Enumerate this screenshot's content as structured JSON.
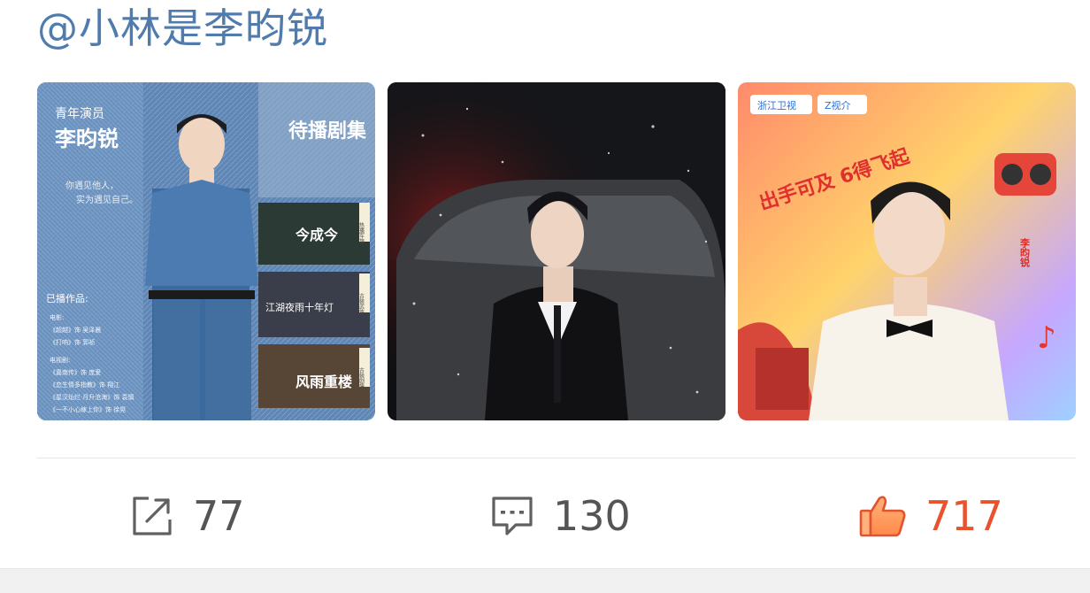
{
  "post": {
    "mention": "@小林是李昀锐"
  },
  "images": [
    {
      "title": "待播剧集",
      "subtitle_role": "青年演员",
      "name": "李昀锐",
      "quote_lines": [
        "你遇见他人，",
        "实为遇见自己。"
      ],
      "works_heading": "已播作品:",
      "works_lines": [
        "电影:",
        "《超越》饰 吴泽晨",
        "《打响》饰 郭祯",
        "电视剧:",
        "《嘉南传》饰 庞爱",
        "《恋生情多指教》饰 翔江",
        "《星汉灿烂·月升沧海》饰 袁慎",
        "《一不小心嫁上你》饰 徐晃"
      ],
      "panels": [
        {
          "title": "今成今",
          "tag": "热播军旅"
        },
        {
          "title": "江湖夜雨十年灯",
          "tag": "古装武侠"
        },
        {
          "title": "风雨重楼",
          "tag": "古装剧情"
        }
      ]
    },
    {
      "description_free": true
    },
    {
      "channel_badges": [
        "浙江卫视",
        "Z视介"
      ],
      "headline": "出手可及 6得飞起",
      "name_tag": "李昀锐"
    }
  ],
  "actions": {
    "repost_count": "77",
    "comment_count": "130",
    "like_count": "717"
  },
  "colors": {
    "mention": "#4f7cac",
    "like_active": "#e8532e",
    "count_text": "#555555",
    "divider": "#e5e5e5"
  },
  "icons": {
    "repost": "share-arrow-icon",
    "comment": "comment-bubble-icon",
    "like": "thumbs-up-icon"
  }
}
